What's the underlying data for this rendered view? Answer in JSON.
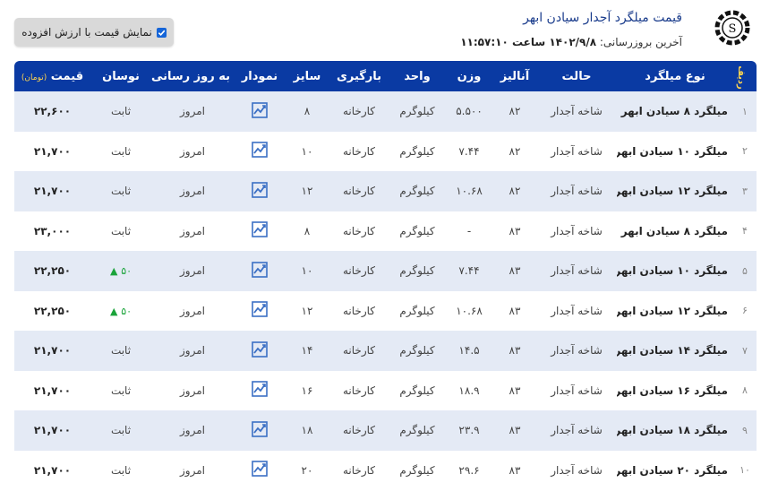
{
  "header": {
    "title": "قیمت میلگرد آجدار سیادن ابهر",
    "updated_label": "آخرین بروزرسانی:",
    "updated_value": "۱۴۰۲/۹/۸ ساعت ۱۱:۵۷:۱۰",
    "vat_button_label": "نمایش قیمت با ارزش افزوده",
    "vat_checked": true,
    "logo_letter": "S",
    "accent_color": "#0a3aa3"
  },
  "table": {
    "columns": {
      "row": "ردیف",
      "type": "نوع میلگرد",
      "state": "حالت",
      "analysis": "آنالیز",
      "weight": "وزن",
      "unit": "واحد",
      "loading": "بارگیری",
      "size": "سایز",
      "chart": "نمودار",
      "updated": "به روز رسانی",
      "change": "نوسان",
      "price": "قیمت",
      "price_unit": "(تومان)"
    },
    "rows": [
      {
        "idx": "۱",
        "type": "میلگرد ۸ سیادن ابهر",
        "state": "شاخه آجدار",
        "analysis": "۸۲",
        "weight": "۵.۵۰۰",
        "unit": "کیلوگرم",
        "loading": "کارخانه",
        "size": "۸",
        "updated": "امروز",
        "change": "ثابت",
        "change_up": false,
        "price": "۲۲,۶۰۰"
      },
      {
        "idx": "۲",
        "type": "میلگرد ۱۰ سیادن ابهر",
        "state": "شاخه آجدار",
        "analysis": "۸۲",
        "weight": "۷.۴۴",
        "unit": "کیلوگرم",
        "loading": "کارخانه",
        "size": "۱۰",
        "updated": "امروز",
        "change": "ثابت",
        "change_up": false,
        "price": "۲۱,۷۰۰"
      },
      {
        "idx": "۳",
        "type": "میلگرد ۱۲ سیادن ابهر",
        "state": "شاخه آجدار",
        "analysis": "۸۲",
        "weight": "۱۰.۶۸",
        "unit": "کیلوگرم",
        "loading": "کارخانه",
        "size": "۱۲",
        "updated": "امروز",
        "change": "ثابت",
        "change_up": false,
        "price": "۲۱,۷۰۰"
      },
      {
        "idx": "۴",
        "type": "میلگرد ۸ سیادن ابهر",
        "state": "شاخه آجدار",
        "analysis": "۸۳",
        "weight": "-",
        "unit": "کیلوگرم",
        "loading": "کارخانه",
        "size": "۸",
        "updated": "امروز",
        "change": "ثابت",
        "change_up": false,
        "price": "۲۳,۰۰۰"
      },
      {
        "idx": "۵",
        "type": "میلگرد ۱۰ سیادن ابهر",
        "state": "شاخه آجدار",
        "analysis": "۸۳",
        "weight": "۷.۴۴",
        "unit": "کیلوگرم",
        "loading": "کارخانه",
        "size": "۱۰",
        "updated": "امروز",
        "change": "۵۰",
        "change_up": true,
        "price": "۲۲,۲۵۰"
      },
      {
        "idx": "۶",
        "type": "میلگرد ۱۲ سیادن ابهر",
        "state": "شاخه آجدار",
        "analysis": "۸۳",
        "weight": "۱۰.۶۸",
        "unit": "کیلوگرم",
        "loading": "کارخانه",
        "size": "۱۲",
        "updated": "امروز",
        "change": "۵۰",
        "change_up": true,
        "price": "۲۲,۲۵۰"
      },
      {
        "idx": "۷",
        "type": "میلگرد ۱۴ سیادن ابهر",
        "state": "شاخه آجدار",
        "analysis": "۸۳",
        "weight": "۱۴.۵",
        "unit": "کیلوگرم",
        "loading": "کارخانه",
        "size": "۱۴",
        "updated": "امروز",
        "change": "ثابت",
        "change_up": false,
        "price": "۲۱,۷۰۰"
      },
      {
        "idx": "۸",
        "type": "میلگرد ۱۶ سیادن ابهر",
        "state": "شاخه آجدار",
        "analysis": "۸۳",
        "weight": "۱۸.۹",
        "unit": "کیلوگرم",
        "loading": "کارخانه",
        "size": "۱۶",
        "updated": "امروز",
        "change": "ثابت",
        "change_up": false,
        "price": "۲۱,۷۰۰"
      },
      {
        "idx": "۹",
        "type": "میلگرد ۱۸ سیادن ابهر",
        "state": "شاخه آجدار",
        "analysis": "۸۳",
        "weight": "۲۳.۹",
        "unit": "کیلوگرم",
        "loading": "کارخانه",
        "size": "۱۸",
        "updated": "امروز",
        "change": "ثابت",
        "change_up": false,
        "price": "۲۱,۷۰۰"
      },
      {
        "idx": "۱۰",
        "type": "میلگرد ۲۰ سیادن ابهر",
        "state": "شاخه آجدار",
        "analysis": "۸۳",
        "weight": "۲۹.۶",
        "unit": "کیلوگرم",
        "loading": "کارخانه",
        "size": "۲۰",
        "updated": "امروز",
        "change": "ثابت",
        "change_up": false,
        "price": "۲۱,۷۰۰"
      }
    ],
    "up_color": "#1aa33a",
    "chart_icon_color": "#3b6fc4"
  }
}
